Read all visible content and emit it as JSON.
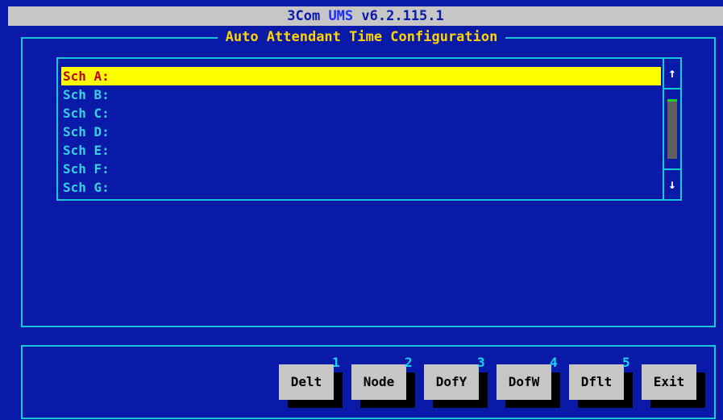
{
  "titlebar": {
    "product": "3Com",
    "product_highlight": "UMS",
    "version": "v6.2.115.1"
  },
  "dialog": {
    "title": "Auto Attendant Time Configuration"
  },
  "schedules": [
    "Sch A:",
    "Sch B:",
    "Sch C:",
    "Sch D:",
    "Sch E:",
    "Sch F:",
    "Sch G:"
  ],
  "selected_index": 0,
  "scrollbar": {
    "up_icon": "arrow-up-icon",
    "down_icon": "arrow-down-icon"
  },
  "buttons": [
    {
      "label": "Delt",
      "key": "1"
    },
    {
      "label": "Node",
      "key": "2"
    },
    {
      "label": "DofY",
      "key": "3"
    },
    {
      "label": "DofW",
      "key": "4"
    },
    {
      "label": "Dflt",
      "key": "5"
    },
    {
      "label": "Exit",
      "key": ""
    }
  ],
  "colors": {
    "background": "#0a1aa8",
    "border": "#17c8d6",
    "title_text": "#ffd400",
    "item_text": "#36d2e2",
    "selected_bg": "#ffff00",
    "selected_text": "#c00000"
  }
}
